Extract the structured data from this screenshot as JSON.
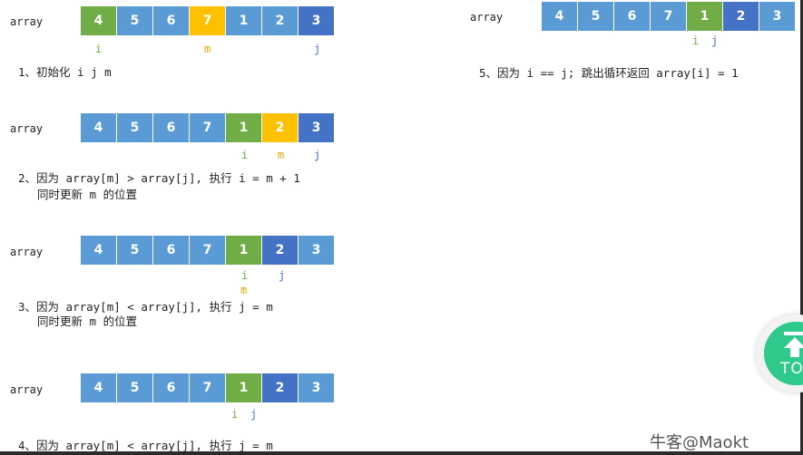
{
  "diagrams": [
    {
      "label": "array",
      "cells": [
        {
          "v": "4",
          "color": "#70ad47"
        },
        {
          "v": "5",
          "color": "#5b9bd5"
        },
        {
          "v": "6",
          "color": "#5b9bd5"
        },
        {
          "v": "7",
          "color": "#ffc000"
        },
        {
          "v": "1",
          "color": "#5b9bd5"
        },
        {
          "v": "2",
          "color": "#5b9bd5"
        },
        {
          "v": "3",
          "color": "#4472c4"
        }
      ],
      "pointers": {
        "i": "i",
        "m": "m",
        "j": "j"
      },
      "step": "1、初始化 i j m"
    },
    {
      "label": "array",
      "cells": [
        {
          "v": "4",
          "color": "#5b9bd5"
        },
        {
          "v": "5",
          "color": "#5b9bd5"
        },
        {
          "v": "6",
          "color": "#5b9bd5"
        },
        {
          "v": "7",
          "color": "#5b9bd5"
        },
        {
          "v": "1",
          "color": "#70ad47"
        },
        {
          "v": "2",
          "color": "#ffc000"
        },
        {
          "v": "3",
          "color": "#4472c4"
        }
      ],
      "pointers": {
        "i": "i",
        "m": "m",
        "j": "j"
      },
      "step_line1": "2、因为 array[m] > array[j], 执行 i = m + 1",
      "step_line2": "同时更新 m 的位置"
    },
    {
      "label": "array",
      "cells": [
        {
          "v": "4",
          "color": "#5b9bd5"
        },
        {
          "v": "5",
          "color": "#5b9bd5"
        },
        {
          "v": "6",
          "color": "#5b9bd5"
        },
        {
          "v": "7",
          "color": "#5b9bd5"
        },
        {
          "v": "1",
          "color": "#70ad47"
        },
        {
          "v": "2",
          "color": "#4472c4"
        },
        {
          "v": "3",
          "color": "#5b9bd5"
        }
      ],
      "pointers": {
        "i": "i",
        "m": "m",
        "j": "j"
      },
      "step_line1": "3、因为 array[m] < array[j], 执行 j = m",
      "step_line2": "同时更新 m 的位置"
    },
    {
      "label": "array",
      "cells": [
        {
          "v": "4",
          "color": "#5b9bd5"
        },
        {
          "v": "5",
          "color": "#5b9bd5"
        },
        {
          "v": "6",
          "color": "#5b9bd5"
        },
        {
          "v": "7",
          "color": "#5b9bd5"
        },
        {
          "v": "1",
          "color": "#70ad47"
        },
        {
          "v": "2",
          "color": "#4472c4"
        },
        {
          "v": "3",
          "color": "#5b9bd5"
        }
      ],
      "pointers": {
        "i": "i",
        "j": "j"
      },
      "step": "4、因为 array[m] < array[j], 执行 j = m"
    },
    {
      "label": "array",
      "cells": [
        {
          "v": "4",
          "color": "#5b9bd5"
        },
        {
          "v": "5",
          "color": "#5b9bd5"
        },
        {
          "v": "6",
          "color": "#5b9bd5"
        },
        {
          "v": "7",
          "color": "#5b9bd5"
        },
        {
          "v": "1",
          "color": "#70ad47"
        },
        {
          "v": "2",
          "color": "#4472c4"
        },
        {
          "v": "3",
          "color": "#5b9bd5"
        }
      ],
      "pointers": {
        "i": "i",
        "j": "j"
      },
      "step": "5、因为 i == j; 跳出循环返回 array[i] = 1"
    }
  ],
  "back_to_top": {
    "label": "TO",
    "icon": "arrow-up-icon"
  },
  "watermark": "牛客@Maokt"
}
